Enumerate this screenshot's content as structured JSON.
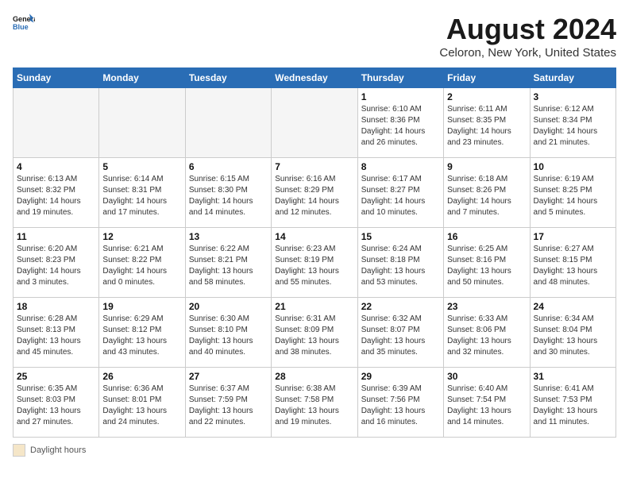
{
  "header": {
    "logo_line1": "General",
    "logo_line2": "Blue",
    "month_year": "August 2024",
    "location": "Celoron, New York, United States"
  },
  "days_of_week": [
    "Sunday",
    "Monday",
    "Tuesday",
    "Wednesday",
    "Thursday",
    "Friday",
    "Saturday"
  ],
  "weeks": [
    [
      {
        "day": "",
        "empty": true
      },
      {
        "day": "",
        "empty": true
      },
      {
        "day": "",
        "empty": true
      },
      {
        "day": "",
        "empty": true
      },
      {
        "day": "1",
        "sunrise": "6:10 AM",
        "sunset": "8:36 PM",
        "daylight": "14 hours and 26 minutes."
      },
      {
        "day": "2",
        "sunrise": "6:11 AM",
        "sunset": "8:35 PM",
        "daylight": "14 hours and 23 minutes."
      },
      {
        "day": "3",
        "sunrise": "6:12 AM",
        "sunset": "8:34 PM",
        "daylight": "14 hours and 21 minutes."
      }
    ],
    [
      {
        "day": "4",
        "sunrise": "6:13 AM",
        "sunset": "8:32 PM",
        "daylight": "14 hours and 19 minutes."
      },
      {
        "day": "5",
        "sunrise": "6:14 AM",
        "sunset": "8:31 PM",
        "daylight": "14 hours and 17 minutes."
      },
      {
        "day": "6",
        "sunrise": "6:15 AM",
        "sunset": "8:30 PM",
        "daylight": "14 hours and 14 minutes."
      },
      {
        "day": "7",
        "sunrise": "6:16 AM",
        "sunset": "8:29 PM",
        "daylight": "14 hours and 12 minutes."
      },
      {
        "day": "8",
        "sunrise": "6:17 AM",
        "sunset": "8:27 PM",
        "daylight": "14 hours and 10 minutes."
      },
      {
        "day": "9",
        "sunrise": "6:18 AM",
        "sunset": "8:26 PM",
        "daylight": "14 hours and 7 minutes."
      },
      {
        "day": "10",
        "sunrise": "6:19 AM",
        "sunset": "8:25 PM",
        "daylight": "14 hours and 5 minutes."
      }
    ],
    [
      {
        "day": "11",
        "sunrise": "6:20 AM",
        "sunset": "8:23 PM",
        "daylight": "14 hours and 3 minutes."
      },
      {
        "day": "12",
        "sunrise": "6:21 AM",
        "sunset": "8:22 PM",
        "daylight": "14 hours and 0 minutes."
      },
      {
        "day": "13",
        "sunrise": "6:22 AM",
        "sunset": "8:21 PM",
        "daylight": "13 hours and 58 minutes."
      },
      {
        "day": "14",
        "sunrise": "6:23 AM",
        "sunset": "8:19 PM",
        "daylight": "13 hours and 55 minutes."
      },
      {
        "day": "15",
        "sunrise": "6:24 AM",
        "sunset": "8:18 PM",
        "daylight": "13 hours and 53 minutes."
      },
      {
        "day": "16",
        "sunrise": "6:25 AM",
        "sunset": "8:16 PM",
        "daylight": "13 hours and 50 minutes."
      },
      {
        "day": "17",
        "sunrise": "6:27 AM",
        "sunset": "8:15 PM",
        "daylight": "13 hours and 48 minutes."
      }
    ],
    [
      {
        "day": "18",
        "sunrise": "6:28 AM",
        "sunset": "8:13 PM",
        "daylight": "13 hours and 45 minutes."
      },
      {
        "day": "19",
        "sunrise": "6:29 AM",
        "sunset": "8:12 PM",
        "daylight": "13 hours and 43 minutes."
      },
      {
        "day": "20",
        "sunrise": "6:30 AM",
        "sunset": "8:10 PM",
        "daylight": "13 hours and 40 minutes."
      },
      {
        "day": "21",
        "sunrise": "6:31 AM",
        "sunset": "8:09 PM",
        "daylight": "13 hours and 38 minutes."
      },
      {
        "day": "22",
        "sunrise": "6:32 AM",
        "sunset": "8:07 PM",
        "daylight": "13 hours and 35 minutes."
      },
      {
        "day": "23",
        "sunrise": "6:33 AM",
        "sunset": "8:06 PM",
        "daylight": "13 hours and 32 minutes."
      },
      {
        "day": "24",
        "sunrise": "6:34 AM",
        "sunset": "8:04 PM",
        "daylight": "13 hours and 30 minutes."
      }
    ],
    [
      {
        "day": "25",
        "sunrise": "6:35 AM",
        "sunset": "8:03 PM",
        "daylight": "13 hours and 27 minutes."
      },
      {
        "day": "26",
        "sunrise": "6:36 AM",
        "sunset": "8:01 PM",
        "daylight": "13 hours and 24 minutes."
      },
      {
        "day": "27",
        "sunrise": "6:37 AM",
        "sunset": "7:59 PM",
        "daylight": "13 hours and 22 minutes."
      },
      {
        "day": "28",
        "sunrise": "6:38 AM",
        "sunset": "7:58 PM",
        "daylight": "13 hours and 19 minutes."
      },
      {
        "day": "29",
        "sunrise": "6:39 AM",
        "sunset": "7:56 PM",
        "daylight": "13 hours and 16 minutes."
      },
      {
        "day": "30",
        "sunrise": "6:40 AM",
        "sunset": "7:54 PM",
        "daylight": "13 hours and 14 minutes."
      },
      {
        "day": "31",
        "sunrise": "6:41 AM",
        "sunset": "7:53 PM",
        "daylight": "13 hours and 11 minutes."
      }
    ]
  ],
  "legend": {
    "daylight_label": "Daylight hours"
  }
}
